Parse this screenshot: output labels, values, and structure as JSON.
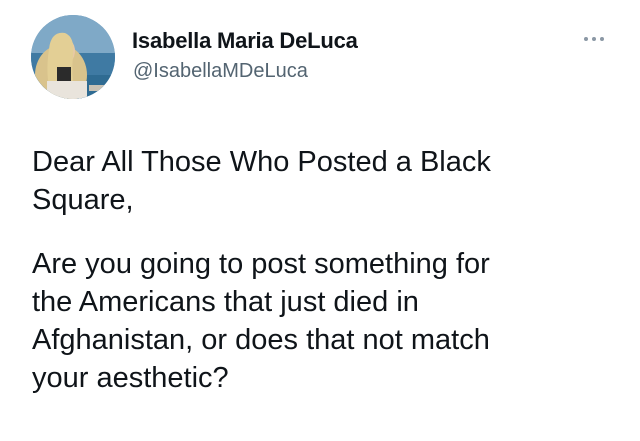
{
  "author": {
    "display_name": "Isabella Maria DeLuca",
    "handle": "@IsabellaMDeLuca",
    "avatar_icon": "profile-photo"
  },
  "menu": {
    "icon": "more-horizontal-icon"
  },
  "tweet": {
    "paragraph_1": {
      "line_1": "Dear All Those Who Posted a Black",
      "line_2": "Square,"
    },
    "paragraph_2": {
      "line_1": "Are you going to post something for",
      "line_2": "the Americans that just died in",
      "line_3": "Afghanistan, or does that not match",
      "line_4": "your aesthetic?"
    }
  },
  "colors": {
    "text": "#0f1419",
    "secondary_text": "#536471",
    "background": "#ffffff"
  }
}
